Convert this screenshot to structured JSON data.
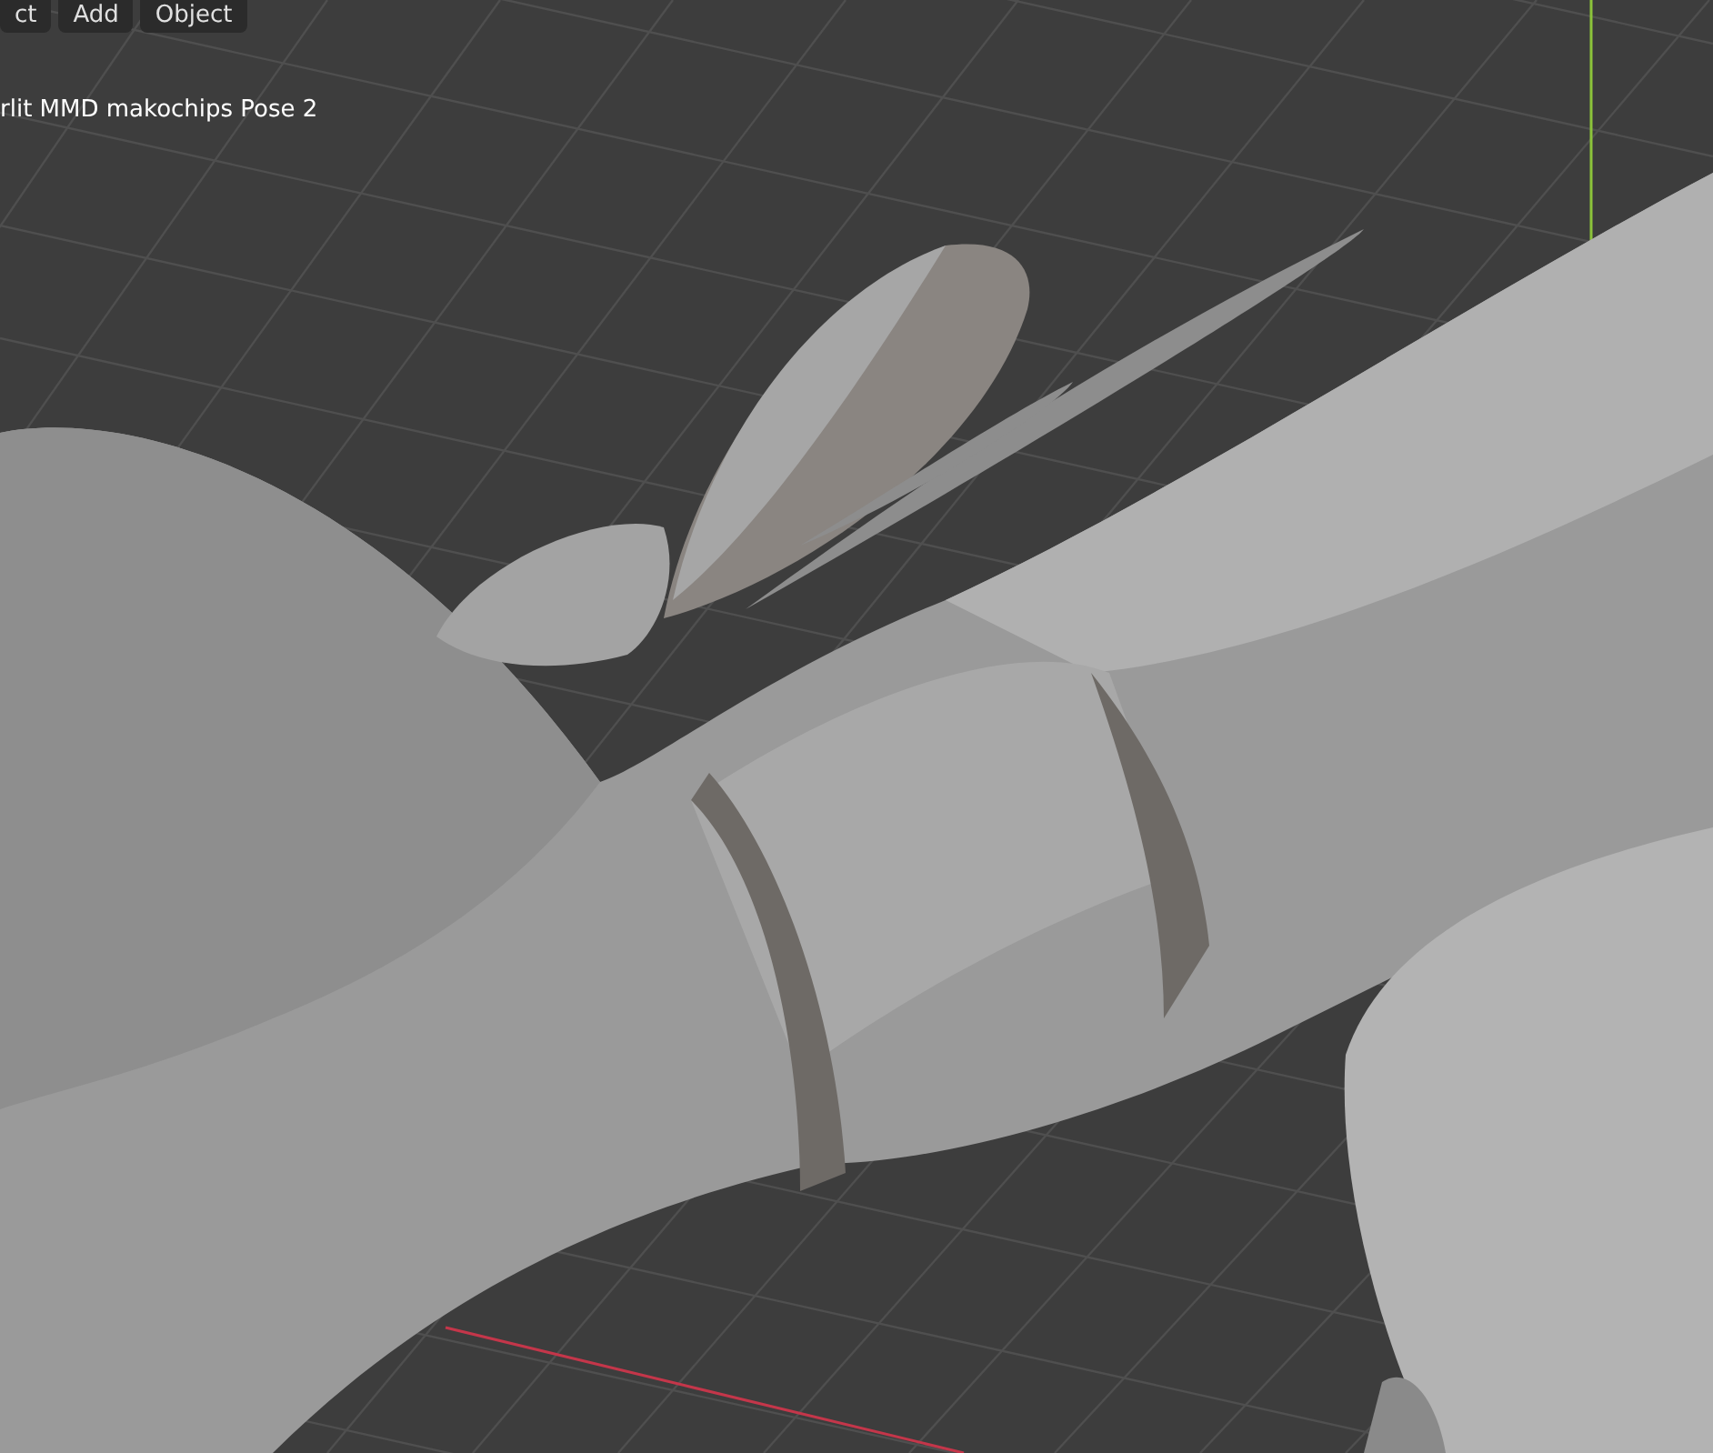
{
  "header_menu": [
    {
      "label": "ct"
    },
    {
      "label": "Add"
    },
    {
      "label": "Object"
    }
  ],
  "viewport": {
    "object_label": "rlit MMD makochips Pose 2"
  }
}
